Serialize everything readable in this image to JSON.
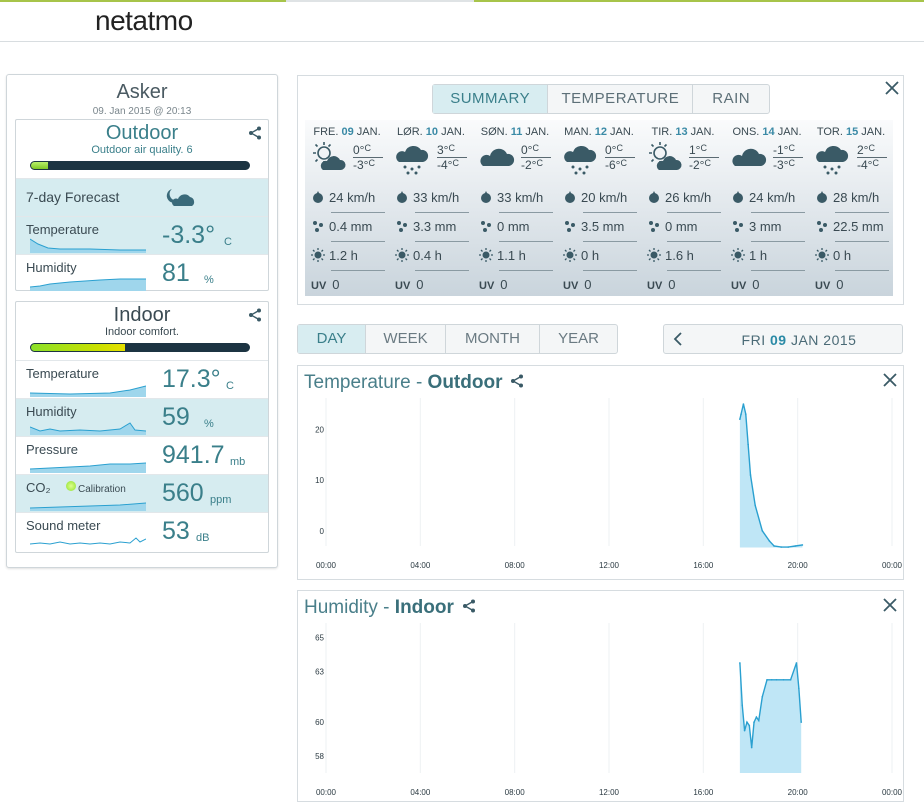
{
  "brand": "netatmo",
  "station": {
    "name": "Asker",
    "datetime": "09. Jan 2015 @ 20:13"
  },
  "outdoor": {
    "title": "Outdoor",
    "subtitle": "Outdoor air quality. 6",
    "bar_fraction": 0.08,
    "forecast_label": "7-day Forecast",
    "rows": [
      {
        "label": "Temperature",
        "value": "-3.3°",
        "unit": "C"
      },
      {
        "label": "Humidity",
        "value": "81",
        "unit": "%"
      }
    ]
  },
  "indoor": {
    "title": "Indoor",
    "subtitle": "Indoor comfort.",
    "bar_fraction": 0.43,
    "rows": [
      {
        "label": "Temperature",
        "value": "17.3°",
        "unit": "C"
      },
      {
        "label": "Humidity",
        "value": "59",
        "unit": "%"
      },
      {
        "label": "Pressure",
        "value": "941.7",
        "unit": "mb"
      },
      {
        "label": "CO₂",
        "value": "560",
        "unit": "ppm",
        "extra": "Calibration"
      },
      {
        "label": "Sound meter",
        "value": "53",
        "unit": "dB"
      }
    ]
  },
  "forecast": {
    "tabs": [
      "SUMMARY",
      "TEMPERATURE",
      "RAIN"
    ],
    "active_tab": "SUMMARY",
    "days": [
      {
        "dow": "FRE.",
        "date": "09",
        "mon": "JAN.",
        "icon": "sun-cloud-icon",
        "tmax": "0°",
        "tmin": "-3°",
        "wind": "24 km/h",
        "rain": "0.4 mm",
        "sun": "1.2 h",
        "uv": "0"
      },
      {
        "dow": "LØR.",
        "date": "10",
        "mon": "JAN.",
        "icon": "cloud-snow-icon",
        "tmax": "3°",
        "tmin": "-4°",
        "wind": "33 km/h",
        "rain": "3.3 mm",
        "sun": "0.4 h",
        "uv": "0"
      },
      {
        "dow": "SØN.",
        "date": "11",
        "mon": "JAN.",
        "icon": "cloud-icon",
        "tmax": "0°",
        "tmin": "-2°",
        "wind": "33 km/h",
        "rain": "0 mm",
        "sun": "1.1 h",
        "uv": "0"
      },
      {
        "dow": "MAN.",
        "date": "12",
        "mon": "JAN.",
        "icon": "cloud-snow-icon",
        "tmax": "0°",
        "tmin": "-6°",
        "wind": "20 km/h",
        "rain": "3.5 mm",
        "sun": "0 h",
        "uv": "0"
      },
      {
        "dow": "TIR.",
        "date": "13",
        "mon": "JAN.",
        "icon": "sun-cloud-icon",
        "tmax": "1°",
        "tmin": "-2°",
        "wind": "26 km/h",
        "rain": "0 mm",
        "sun": "1.6 h",
        "uv": "0"
      },
      {
        "dow": "ONS.",
        "date": "14",
        "mon": "JAN.",
        "icon": "cloud-icon",
        "tmax": "-1°",
        "tmin": "-3°",
        "wind": "24 km/h",
        "rain": "3 mm",
        "sun": "1 h",
        "uv": "0"
      },
      {
        "dow": "TOR.",
        "date": "15",
        "mon": "JAN.",
        "icon": "cloud-snow-icon",
        "tmax": "2°",
        "tmin": "-4°",
        "wind": "28 km/h",
        "rain": "22.5 mm",
        "sun": "0 h",
        "uv": "0"
      }
    ],
    "unit_c": "C",
    "uv_label": "UV"
  },
  "periods": [
    "DAY",
    "WEEK",
    "MONTH",
    "YEAR"
  ],
  "active_period": "DAY",
  "date_nav": {
    "dow": "FRI",
    "day": "09",
    "rest": "JAN 2015"
  },
  "charts": {
    "temperature": {
      "title_prefix": "Temperature - ",
      "title_strong": "Outdoor"
    },
    "humidity": {
      "title_prefix": "Humidity - ",
      "title_strong": "Indoor"
    }
  },
  "chart_data": [
    {
      "type": "area",
      "title": "Temperature - Outdoor",
      "x_ticks": [
        "00:00",
        "04:00",
        "08:00",
        "12:00",
        "16:00",
        "20:00",
        "00:00"
      ],
      "y_ticks": [
        0,
        10,
        20
      ],
      "ylim": [
        -3,
        25
      ],
      "xlim": [
        0,
        24
      ],
      "x": [
        17.55,
        17.6,
        17.7,
        17.8,
        17.9,
        18.0,
        18.2,
        18.5,
        18.8,
        19.0,
        19.3,
        19.6,
        19.9,
        20.2
      ],
      "values": [
        22,
        23,
        25,
        23,
        17,
        11,
        5,
        0,
        -2,
        -3,
        -3.2,
        -3.2,
        -3.0,
        -2.8
      ],
      "baseline": -3.3,
      "color": "#2aa0d0"
    },
    {
      "type": "area",
      "title": "Humidity - Indoor",
      "x_ticks": [
        "00:00",
        "04:00",
        "08:00",
        "12:00",
        "16:00",
        "20:00",
        "00:00"
      ],
      "y_ticks": [
        58,
        60,
        63,
        65
      ],
      "ylim": [
        57,
        65.5
      ],
      "xlim": [
        0,
        24
      ],
      "x": [
        17.55,
        17.65,
        17.75,
        17.85,
        17.95,
        18.05,
        18.15,
        18.25,
        18.35,
        18.5,
        18.7,
        18.9,
        19.1,
        19.4,
        19.7,
        19.95,
        20.05,
        20.15
      ],
      "values": [
        63.5,
        61,
        59.5,
        60,
        59.8,
        58.5,
        60,
        60.3,
        60.1,
        61.5,
        62.5,
        62.5,
        62.5,
        62.5,
        62.5,
        63.5,
        62,
        60
      ],
      "baseline": 57,
      "color": "#2aa0d0"
    }
  ],
  "colors": {
    "accent": "#3a7f8a",
    "highlight": "#d6ecf0",
    "bar_dark": "#1c3442",
    "bar_good": "#8be02a",
    "bar_warn": "#d6e000",
    "chart_line": "#2aa0d0",
    "chart_fill": "#bfe6f6"
  }
}
